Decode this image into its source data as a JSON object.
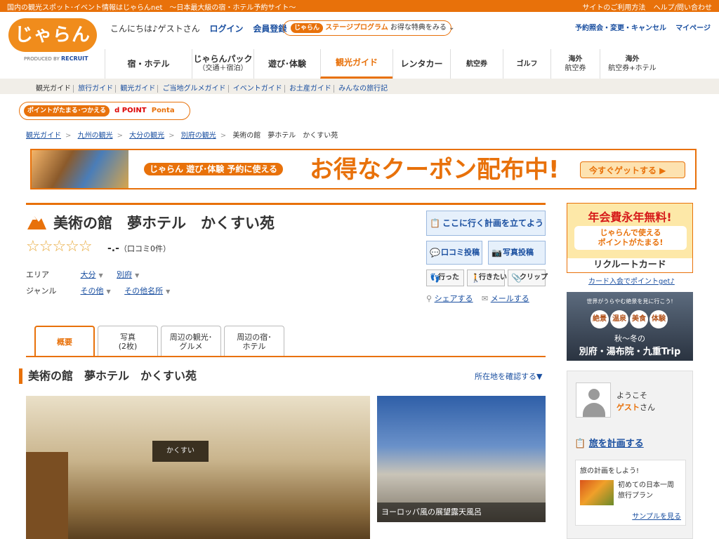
{
  "topbar": {
    "tagline": "国内の観光スポット･イベント情報はじゃらんnet　〜日本最大級の宿・ホテル予約サイト〜",
    "links": [
      "サイトのご利用方法",
      "ヘルプ/問い合わせ"
    ]
  },
  "header": {
    "logo": "じゃらん",
    "produced_by": "PRODUCED BY",
    "produced_brand": "RECRUIT",
    "greeting": "こんにちは♪ゲストさん",
    "login": "ログイン",
    "register": "会員登録",
    "stage_pill": "じゃらん",
    "stage_name": "ステージプログラム",
    "stage_text": "お得な特典をみる",
    "stage_arrow": "⌄",
    "reservation": "予約照会・変更・キャンセル",
    "mypage": "マイページ"
  },
  "nav": [
    {
      "label": "宿・ホテル",
      "sub": ""
    },
    {
      "label": "じゃらんパック",
      "sub": "（交通＋宿泊）"
    },
    {
      "label": "遊び･体験",
      "sub": ""
    },
    {
      "label": "観光ガイド",
      "sub": ""
    },
    {
      "label": "レンタカー",
      "sub": ""
    },
    {
      "label": "航空券",
      "sub": ""
    },
    {
      "label": "ゴルフ",
      "sub": ""
    },
    {
      "label": "海外",
      "sub": "航空券"
    },
    {
      "label": "海外",
      "sub": "航空券+ホテル"
    }
  ],
  "subnav": [
    "観光ガイド",
    "旅行ガイド",
    "観光ガイド",
    "ご当地グルメガイド",
    "イベントガイド",
    "お土産ガイド",
    "みんなの旅行記"
  ],
  "points": {
    "label": "ポイントがたまる･つかえる",
    "dpoint": "d POINT",
    "ponta": "Ponta"
  },
  "breadcrumb": {
    "items": [
      "観光ガイド",
      "九州の観光",
      "大分の観光",
      "別府の観光"
    ],
    "current": "美術の館　夢ホテル　かくすい苑",
    "sep": ">"
  },
  "coupon": {
    "brand": "じゃらん",
    "asobi": "遊び･体験 予約に使える",
    "main": "お得なクーポン配布中!",
    "cta": "今すぐゲットする ▶"
  },
  "spot": {
    "title": "美術の館　夢ホテル　かくすい苑",
    "stars": "☆☆☆☆☆",
    "score": "-.-",
    "reviews": "（口コミ0件）",
    "area_label": "エリア",
    "area_values": [
      "大分",
      "別府"
    ],
    "genre_label": "ジャンル",
    "genre_values": [
      "その他",
      "その他名所"
    ],
    "arrow": "▼"
  },
  "actions": {
    "plan": "ここに行く計画を立てよう",
    "review": "口コミ投稿",
    "photo": "写真投稿",
    "went": "行った",
    "want": "行きたい",
    "clip": "クリップ",
    "share": "シェアする",
    "mail": "メールする"
  },
  "tabs": [
    {
      "label": "概要",
      "sub": ""
    },
    {
      "label": "写真",
      "sub": "(2枚)"
    },
    {
      "label": "周辺の観光･",
      "sub": "グルメ"
    },
    {
      "label": "周辺の宿･",
      "sub": "ホテル"
    }
  ],
  "section": {
    "title": "美術の館　夢ホテル　かくすい苑",
    "location_link": "所在地を確認する▼"
  },
  "photos": {
    "main_sign": "かくすい",
    "side_caption": "ヨーロッパ風の展望露天風呂"
  },
  "recruit_ad": {
    "headline": "年会費永年無料!",
    "mid_line1": "じゃらんで使える",
    "mid_line2": "ポイントがたまる!",
    "foot": "リクルートカード"
  },
  "card_link": "カード入会でポイントget♪",
  "trip_ad": {
    "tagline": "世界がうらやむ絶景を見に行こう!",
    "badges": [
      "絶景",
      "温泉",
      "美食",
      "体験"
    ],
    "season": "秋〜冬の",
    "places": "別府・湯布院・九重Trip"
  },
  "sidebar": {
    "welcome": "ようこそ",
    "guest": "ゲスト",
    "san": "さん",
    "plan_title": "旅を計画する",
    "plan_box_title": "旅の計画をしよう!",
    "plan_desc_1": "初めての日本一周",
    "plan_desc_2": "旅行プラン",
    "sample": "サンプルを見る"
  },
  "colors": {
    "accent": "#e8710a",
    "link": "#1a4fa0"
  }
}
